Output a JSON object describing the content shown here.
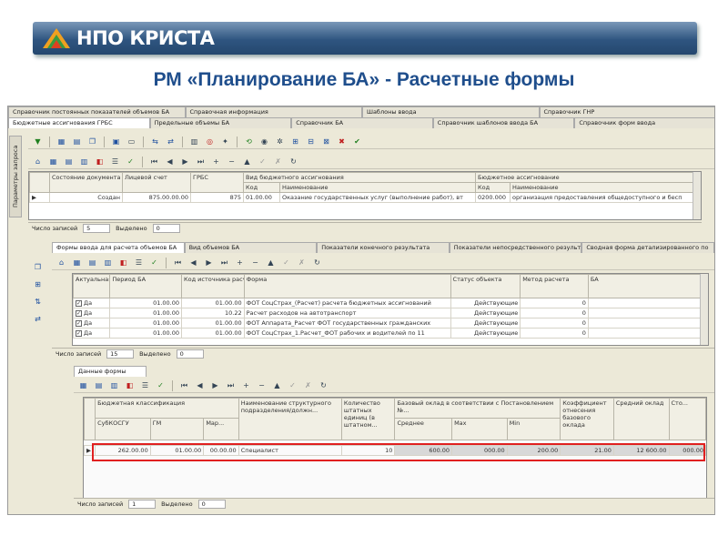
{
  "banner": {
    "brand": "НПО КРИСТА"
  },
  "slide_title": "РМ «Планирование БА» - Расчетные формы",
  "top_tabs_row1": [
    "Справочник постоянных показателей объемов БА",
    "Справочная информация",
    "Шаблоны ввода",
    "Справочник ГНР"
  ],
  "top_tabs_row2": [
    "Бюджетные ассигнования ГРБС",
    "Предельные объемы БА",
    "Справочник БА",
    "Справочник шаблонов ввода БА",
    "Справочник форм ввода"
  ],
  "left_vtab": "Параметры запроса",
  "upper_grid": {
    "headers": {
      "status": "Состояние документа",
      "account": "Лицевой счет",
      "grbs": "ГРБС",
      "kind_group": "Вид бюджетного ассигнования",
      "kind_code": "Код",
      "kind_name": "Наименование",
      "ba_group": "Бюджетное ассигнование",
      "ba_code": "Код",
      "ba_name": "Наименование"
    },
    "row": {
      "status": "Создан",
      "account": "875.00.00.00",
      "grbs": "875",
      "kind_code": "01.00.00",
      "kind_name": "Оказание государственных услуг (выполнение работ), вт",
      "ba_code": "0200.000",
      "ba_name": "организация предоставления общедоступного и бесп"
    },
    "footer": {
      "records_label": "Число записей",
      "records": "5",
      "selected_label": "Выделено",
      "selected": "0"
    }
  },
  "middle_tabs": [
    "Формы ввода для расчета объемов БА",
    "Вид объемов БА",
    "Показатели конечного результата",
    "Показатели непосредственного результата",
    "Сводная форма детализированного по"
  ],
  "middle_grid": {
    "headers": {
      "active": "Актуальная форма",
      "period": "Период БА",
      "kind": "Код источника расчета",
      "form": "Форма",
      "status": "Статус объекта",
      "method": "Метод расчета",
      "ba": "БА"
    },
    "rows": [
      {
        "active": "Да",
        "period": "01.00.00",
        "kind": "01.00.00",
        "form": "ФОТ СоцСтрах_(Расчет) расчета бюджетных ассигнований",
        "status": "Действующие",
        "method": "0"
      },
      {
        "active": "Да",
        "period": "01.00.00",
        "kind": "10.22",
        "form": "Расчет расходов на автотранспорт",
        "status": "Действующие",
        "method": "0"
      },
      {
        "active": "Да",
        "period": "01.00.00",
        "kind": "01.00.00",
        "form": "ФОТ Аппарата_Расчет ФОТ государственных гражданских",
        "status": "Действующие",
        "method": "0"
      },
      {
        "active": "Да",
        "period": "01.00.00",
        "kind": "01.00.00",
        "form": "ФОТ СоцСтрах_1.Расчет_ФОТ рабочих и водителей по 11",
        "status": "Действующие",
        "method": "0"
      }
    ],
    "footer": {
      "records_label": "Число записей",
      "records": "15",
      "selected_label": "Выделено",
      "selected": "0"
    }
  },
  "data_tab": "Данные формы",
  "lower_grid": {
    "headers": {
      "budget_class": "Бюджетная классификация",
      "kosgu": "СубКОСГУ",
      "gm": "ГМ",
      "mark": "Мар...",
      "position": "Наименование структурного подразделения/должн...",
      "staff": "Количество штатных единиц (в штатном...",
      "salary_group": "Базовый оклад в соответствии с Постановлением №...",
      "avg": "Среднее",
      "max": "Max",
      "min": "Min",
      "coef": "Коэффициент отнесения базового оклада",
      "avg_salary": "Средний оклад",
      "last": "Сто..."
    },
    "row": {
      "kosgu": "262.00.00",
      "gm": "01.00.00",
      "mark": "00.00.00",
      "position": "Специалист",
      "staff": "10",
      "avg": "600.00",
      "max": "000.00",
      "min": "200.00",
      "coef": "21.00",
      "avg_salary": "12 600.00",
      "last": "000.00"
    },
    "footer": {
      "records_label": "Число записей",
      "records": "1",
      "selected_label": "Выделено",
      "selected": "0"
    }
  },
  "colors": {
    "banner": "#2f5580",
    "title": "#1f4e8c",
    "highlight": "#e02020"
  }
}
